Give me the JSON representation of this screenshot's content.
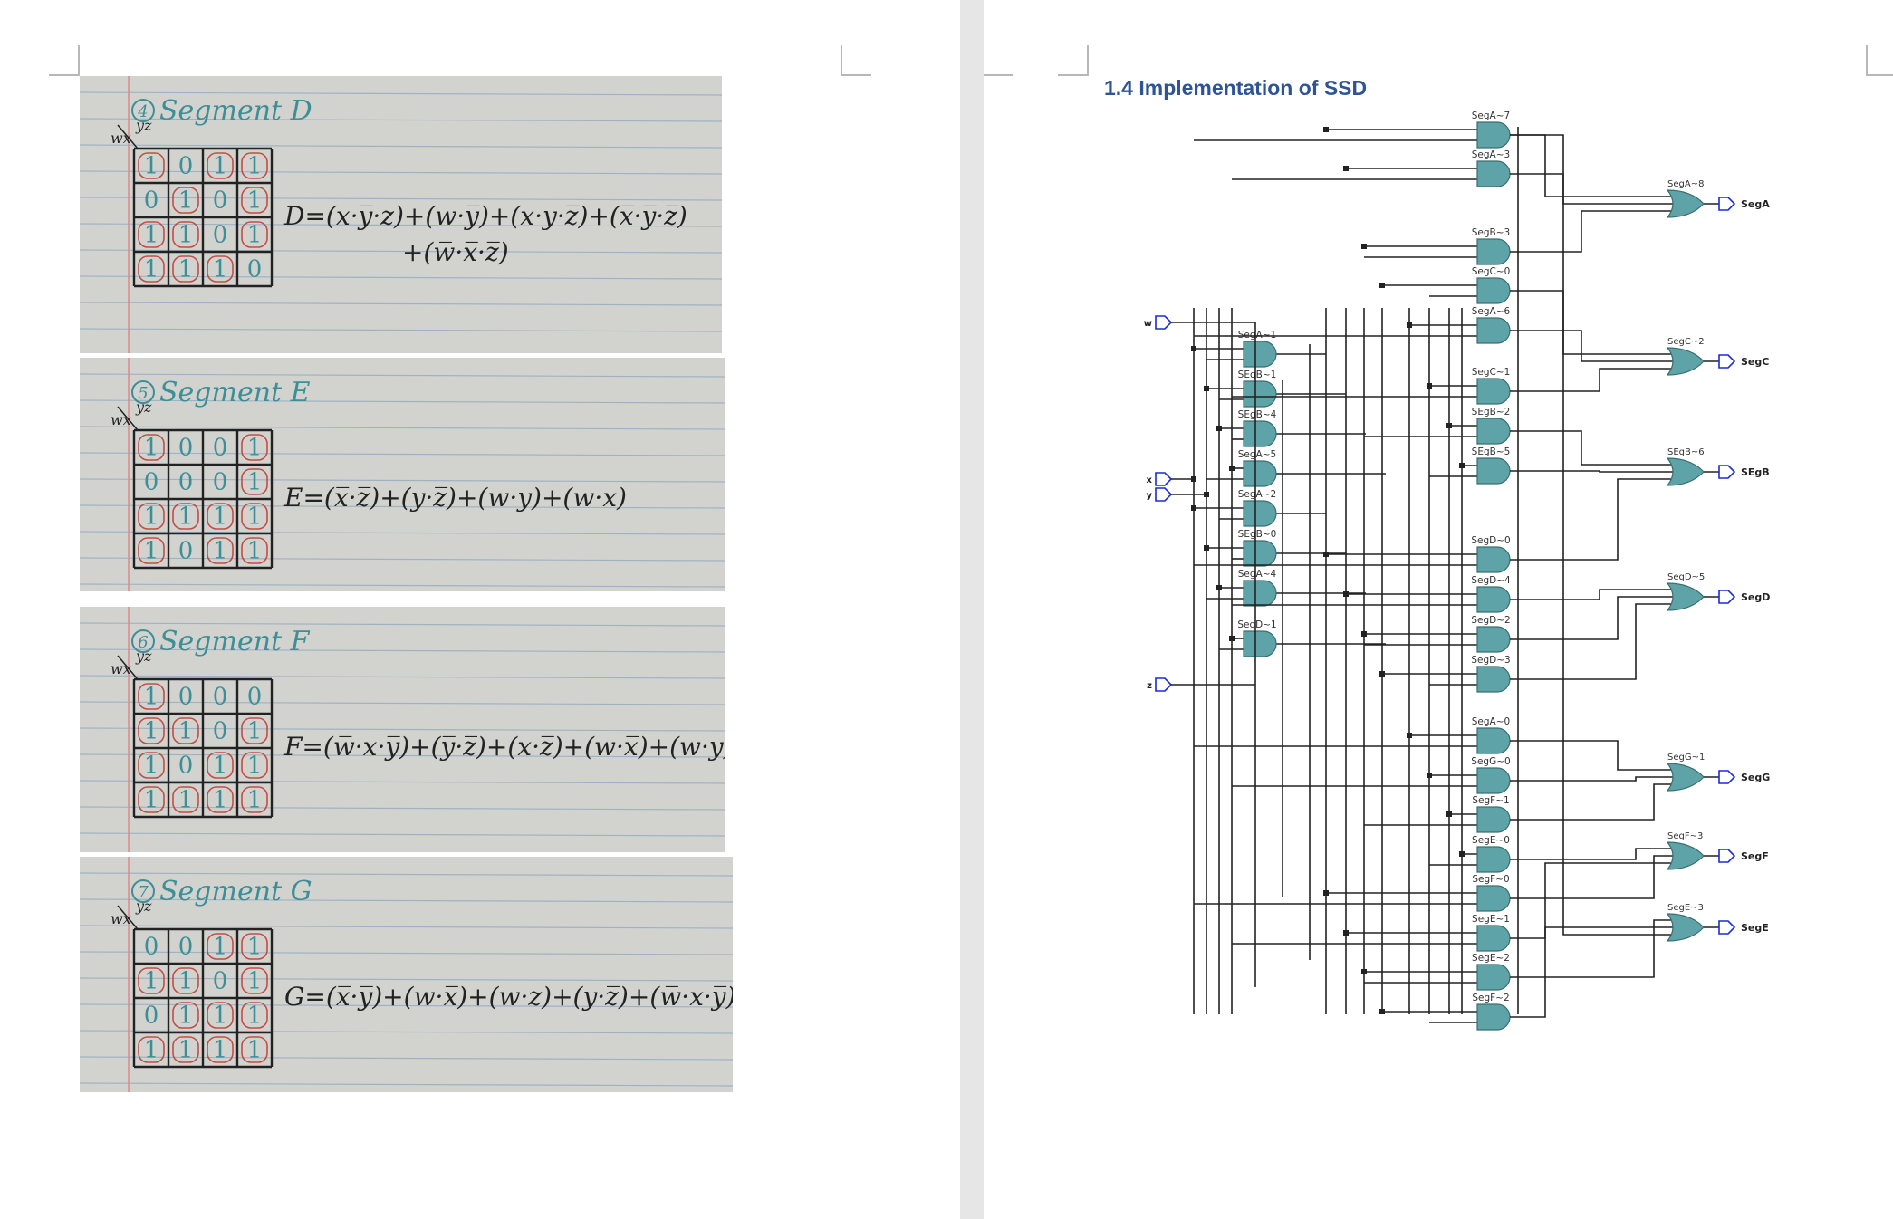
{
  "document": {
    "photos": [
      {
        "title": "Segment D",
        "number": "4",
        "corner": "wx",
        "corner_cols": "yz",
        "grid": [
          [
            "1",
            "0",
            "1",
            "1"
          ],
          [
            "0",
            "1",
            "0",
            "1"
          ],
          [
            "1",
            "1",
            "0",
            "1"
          ],
          [
            "1",
            "1",
            "1",
            "0"
          ]
        ],
        "equation": "D=(x·y̅·z)+(w·y̅)+(x·y·z̅)+(x̅·y̅·z̅)",
        "equation2": "+(w̅·x̅·z̅)"
      },
      {
        "title": "Segment E",
        "number": "5",
        "corner": "wx",
        "corner_cols": "yz",
        "grid": [
          [
            "1",
            "0",
            "0",
            "1"
          ],
          [
            "0",
            "0",
            "0",
            "1"
          ],
          [
            "1",
            "1",
            "1",
            "1"
          ],
          [
            "1",
            "0",
            "1",
            "1"
          ]
        ],
        "equation": "E=(x̅·z̅)+(y·z̅)+(w·y)+(w·x)",
        "equation2": ""
      },
      {
        "title": "Segment F",
        "number": "6",
        "corner": "wx",
        "corner_cols": "yz",
        "grid": [
          [
            "1",
            "0",
            "0",
            "0"
          ],
          [
            "1",
            "1",
            "0",
            "1"
          ],
          [
            "1",
            "0",
            "1",
            "1"
          ],
          [
            "1",
            "1",
            "1",
            "1"
          ]
        ],
        "equation": "F=(w̅·x·y̅)+(y̅·z̅)+(x·z̅)+(w·x̅)+(w·y)",
        "equation2": ""
      },
      {
        "title": "Segment G",
        "number": "7",
        "corner": "wx",
        "corner_cols": "yz",
        "grid": [
          [
            "0",
            "0",
            "1",
            "1"
          ],
          [
            "1",
            "1",
            "0",
            "1"
          ],
          [
            "0",
            "1",
            "1",
            "1"
          ],
          [
            "1",
            "1",
            "1",
            "1"
          ]
        ],
        "equation": "G=(x̅·y̅)+(w·x̅)+(w·z)+(y·z̅)+(w̅·x·y̅)",
        "equation2": ""
      }
    ],
    "heading": "1.4 Implementation of SSD",
    "schematic": {
      "inputs": [
        "w",
        "x",
        "y",
        "z"
      ],
      "and_gates": [
        "SegA~7",
        "SegA~3",
        "SegB~3",
        "SegC~0",
        "SegA~6",
        "SegC~1",
        "SEgB~2",
        "SEgB~5",
        "SegD~0",
        "SegD~4",
        "SegD~2",
        "SegD~3",
        "SegA~0",
        "SegG~0",
        "SegF~1",
        "SegE~0",
        "SegF~0",
        "SegE~1",
        "SegE~2",
        "SegF~2",
        "SegA~1",
        "SEgB~1",
        "SEgB~4",
        "SegA~5",
        "SegA~2",
        "SEgB~0",
        "SegA~4",
        "SegD~1"
      ],
      "or_gates": [
        "SegA~8",
        "SegC~2",
        "SEgB~6",
        "SegD~5",
        "SegG~1",
        "SegF~3",
        "SegE~3"
      ],
      "outputs": [
        "SegA",
        "SegC",
        "SEgB",
        "SegD",
        "SegG",
        "SegF",
        "SegE"
      ]
    }
  },
  "colors": {
    "paper": "#d2d3cf",
    "ink_blue": "#3d8f97",
    "ink_red": "#c0362c",
    "ink_black": "#222222",
    "gate_fill": "#5ea3a7",
    "heading": "#2f5496",
    "io_port": "#1a2bd6"
  }
}
